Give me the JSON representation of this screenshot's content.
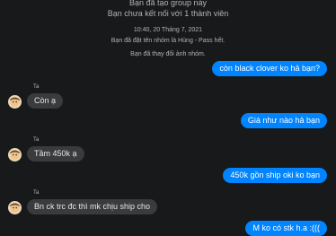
{
  "system": {
    "created_group": "Bạn đã tạo group này",
    "not_connected": "Bạn chưa kết nối với 1 thành viên",
    "timestamp": "10:40, 20 Tháng 7, 2021",
    "group_named": "Bạn đã đặt tên nhóm là Hùng - Pass hết.",
    "changed_photo": "Bạn đã thay đổi ảnh nhóm."
  },
  "messages": [
    {
      "direction": "out",
      "text": "còn black clover ko hả bạn?"
    },
    {
      "direction": "in",
      "sender": "Ta",
      "text": "Còn ạ"
    },
    {
      "direction": "out",
      "text": "Giá như nào hả bạn"
    },
    {
      "direction": "in",
      "sender": "Ta",
      "text": "Tầm 450k ạ"
    },
    {
      "direction": "out",
      "text": "450k gồn ship oki ko bạn"
    },
    {
      "direction": "in",
      "sender": "Ta",
      "text": "Bn ck trc đc thì mk chịu ship cho"
    },
    {
      "direction": "out",
      "text": "M ko có stk h.a :((("
    }
  ],
  "colors": {
    "background": "#18191a",
    "outgoing_bubble": "#0084ff",
    "incoming_bubble": "#3a3b3c",
    "system_text": "#b0b3b8"
  }
}
